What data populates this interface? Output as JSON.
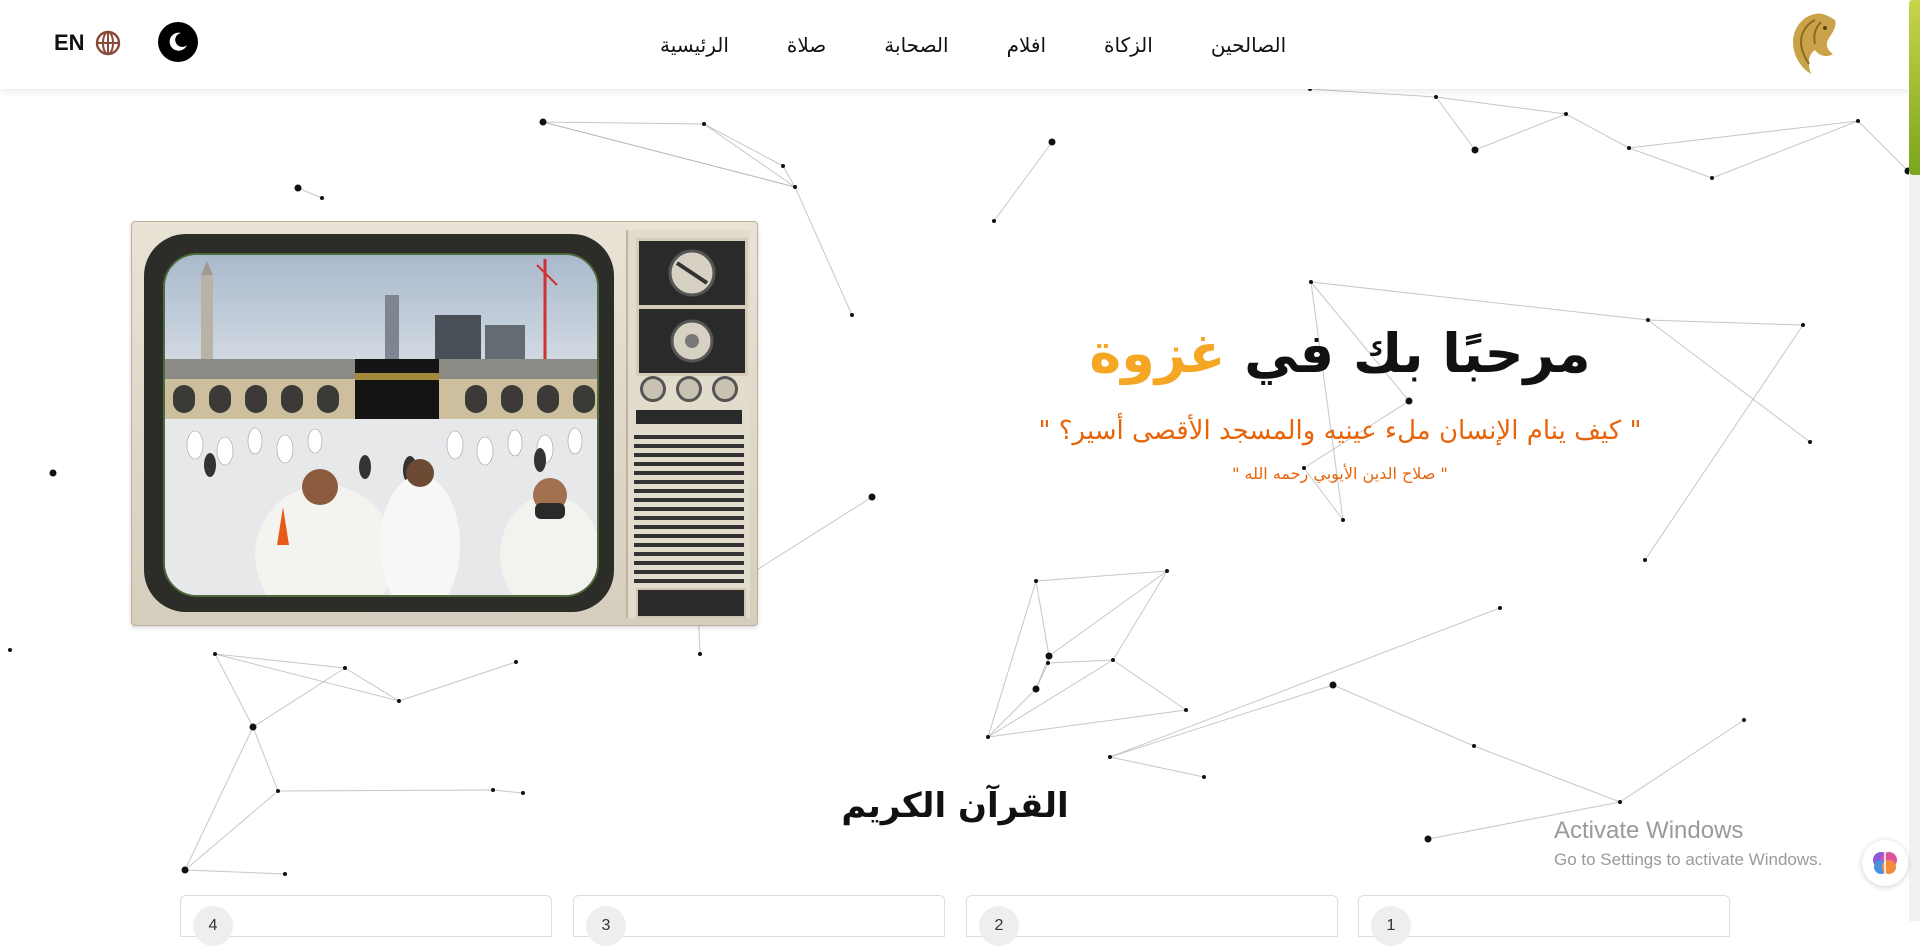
{
  "nav": {
    "links": [
      "الرئيسية",
      "صلاة",
      "الصحابة",
      "افلام",
      "الزكاة",
      "الصالحين"
    ],
    "language": "EN",
    "logo": "horse-head-logo",
    "theme_icon": "moon-icon",
    "language_icon": "globe-icon"
  },
  "hero": {
    "title_prefix": "مرحبًا بك في",
    "title_accent": "غزوة",
    "quote": "\" كيف ينام الإنسان ملء عينيه والمسجد الأقصى أسير؟ \"",
    "author": "\" صلاح الدين الأيوبي رحمه الله \"",
    "accent_color": "#f5a623",
    "quote_color": "#e8640a",
    "tv_image": "kaaba-photo"
  },
  "quran": {
    "title": "القرآن الكريم",
    "cards": [
      {
        "num": "1",
        "name": ""
      },
      {
        "num": "2",
        "name": ""
      },
      {
        "num": "3",
        "name": ""
      },
      {
        "num": "4",
        "name": ""
      }
    ]
  },
  "watermark": {
    "title": "Activate Windows",
    "subtitle": "Go to Settings to activate Windows."
  },
  "chat_icon": "brain-icon"
}
